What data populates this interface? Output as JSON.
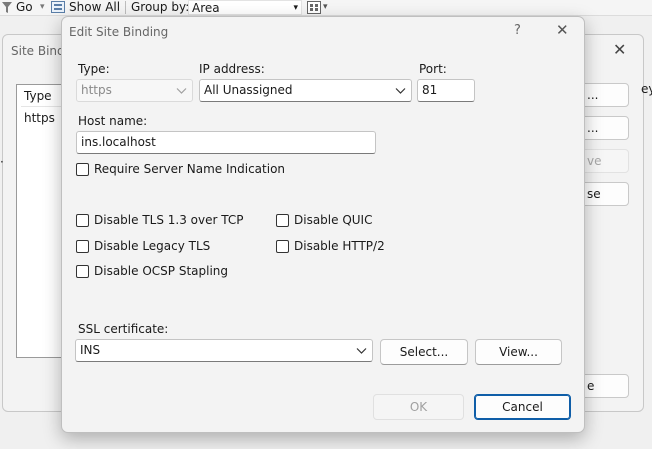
{
  "toolbar": {
    "go_label": "Go",
    "show_all_label": "Show All",
    "group_by_label": "Group by:",
    "group_by_value": "Area"
  },
  "back_dialog": {
    "title": "Site Bindi",
    "list_header": "Type",
    "list_item": "https",
    "buttons": [
      "...",
      "...",
      "ve",
      "se",
      "e"
    ],
    "right_edge_text": "ey"
  },
  "dialog": {
    "title": "Edit Site Binding",
    "help_glyph": "?",
    "close_glyph": "✕",
    "type": {
      "label": "Type:",
      "value": "https"
    },
    "ip": {
      "label": "IP address:",
      "value": "All Unassigned"
    },
    "port": {
      "label": "Port:",
      "value": "81"
    },
    "host": {
      "label": "Host name:",
      "value": "ins.localhost"
    },
    "sni_label": "Require Server Name Indication",
    "options": {
      "tls13": "Disable TLS 1.3 over TCP",
      "legacy_tls": "Disable Legacy TLS",
      "ocsp": "Disable OCSP Stapling",
      "quic": "Disable QUIC",
      "http2": "Disable HTTP/2"
    },
    "ssl": {
      "label": "SSL certificate:",
      "value": "INS"
    },
    "select_label": "Select...",
    "view_label": "View...",
    "ok_label": "OK",
    "cancel_label": "Cancel"
  },
  "colors": {
    "accent": "#0f5ea8",
    "dialog_bg": "#f3f3f3"
  }
}
